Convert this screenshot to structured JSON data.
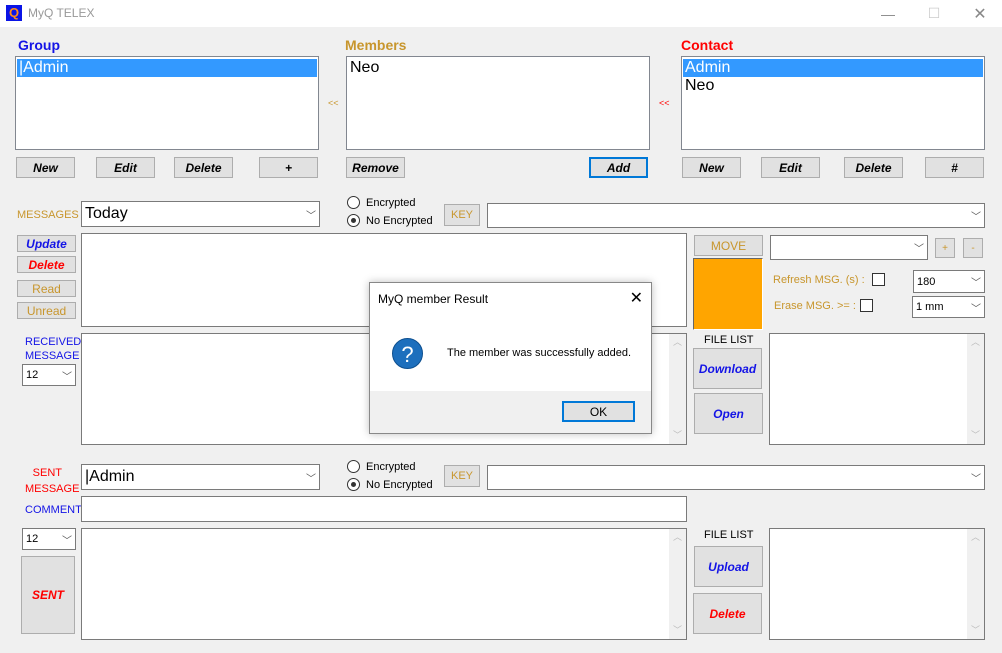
{
  "window": {
    "title": "MyQ TELEX",
    "app_icon_glyph": "Q",
    "controls": {
      "minimize": "—",
      "maximize": "☐",
      "close": "✕"
    }
  },
  "colors": {
    "gold": "#c8962d",
    "blue": "#1414e6",
    "red": "#ff0000",
    "selection": "#3399ff",
    "status_swatch": "#ffa500"
  },
  "group": {
    "title": "Group",
    "items": [
      {
        "label": "|Admin",
        "selected": true
      }
    ],
    "buttons": {
      "new": "New",
      "edit": "Edit",
      "delete": "Delete",
      "plus": "+"
    },
    "arrow": "<<"
  },
  "members": {
    "title": "Members",
    "items": [
      {
        "label": "Neo",
        "selected": false
      }
    ],
    "buttons": {
      "remove": "Remove",
      "add": "Add"
    },
    "arrow": "<<"
  },
  "contact": {
    "title": "Contact",
    "items": [
      {
        "label": "Admin",
        "selected": true
      },
      {
        "label": "Neo",
        "selected": false
      }
    ],
    "buttons": {
      "new": "New",
      "edit": "Edit",
      "delete": "Delete",
      "hash": "#"
    }
  },
  "messages": {
    "label": "MESSAGES",
    "filter_value": "Today",
    "encryption": {
      "encrypted": "Encrypted",
      "no_encrypted": "No Encrypted",
      "selected": "no_encrypted"
    },
    "key_button": "KEY",
    "key_value": "",
    "buttons": {
      "update": "Update",
      "delete": "Delete",
      "read": "Read",
      "unread": "Unread"
    },
    "move_button": "MOVE",
    "move_target": "",
    "plus": "+",
    "minus": "-",
    "refresh_label": "Refresh MSG. (s) :",
    "refresh_checked": false,
    "refresh_value": "180",
    "erase_label": "Erase MSG. >= :",
    "erase_checked": false,
    "erase_value": "1 mm"
  },
  "received": {
    "label_line1": "RECEIVED",
    "label_line2": "MESSAGE",
    "font_size_value": "12",
    "file_list_label": "FILE LIST",
    "download_button": "Download",
    "open_button": "Open"
  },
  "sent": {
    "label_line1": "SENT",
    "label_line2": "MESSAGE",
    "recipient_value": "|Admin",
    "encryption": {
      "encrypted": "Encrypted",
      "no_encrypted": "No Encrypted",
      "selected": "no_encrypted"
    },
    "key_button": "KEY",
    "key_value": "",
    "comment_label": "COMMENT",
    "comment_value": "",
    "font_size_value": "12",
    "send_button": "SENT",
    "file_list_label": "FILE LIST",
    "upload_button": "Upload",
    "delete_button": "Delete"
  },
  "dialog": {
    "title": "MyQ member Result",
    "icon_glyph": "?",
    "message": "The member was successfully added.",
    "ok_button": "OK",
    "close_glyph": "✕"
  },
  "scroll_glyphs": {
    "up": "︿",
    "down": "﹀"
  },
  "chevron": "﹀"
}
